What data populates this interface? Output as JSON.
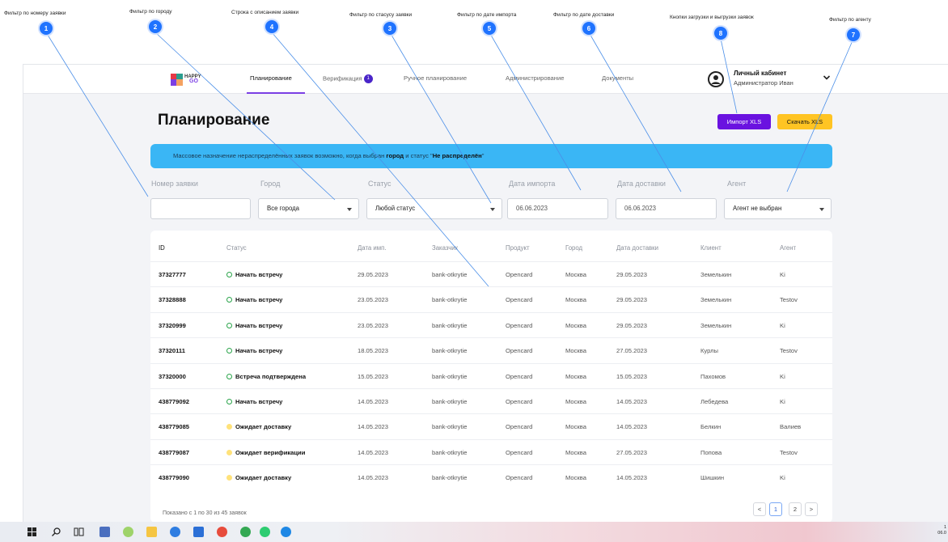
{
  "annotations": [
    {
      "num": "1",
      "label": "Фильтр по номеру заявки"
    },
    {
      "num": "2",
      "label": "Фильтр по городу"
    },
    {
      "num": "4",
      "label": "Строка с описанием заявки"
    },
    {
      "num": "3",
      "label": "Фильтр по стасусу заявки"
    },
    {
      "num": "5",
      "label": "Фильтр по дате импорта"
    },
    {
      "num": "6",
      "label": "Фильтр по дате доставки"
    },
    {
      "num": "8",
      "label": "Кнопки загрузки и выгрузки заявок"
    },
    {
      "num": "7",
      "label": "Фильтр по агенту"
    }
  ],
  "header": {
    "logo": {
      "top": "HAPPY",
      "bottom": "GO"
    },
    "nav": [
      {
        "label": "Планирование",
        "active": true
      },
      {
        "label": "Верификация",
        "badge": "1"
      },
      {
        "label": "Ручное планирование"
      },
      {
        "label": "Администрирование"
      },
      {
        "label": "Документы"
      }
    ],
    "user": {
      "name": "Личный кабинет",
      "role": "Администратор Иван"
    }
  },
  "page": {
    "title": "Планирование",
    "import_label": "Импорт XLS",
    "export_label": "Скачать XLS"
  },
  "banner": {
    "text_1": "Массовое назначение нераспределённых заявок возможно, когда выбран ",
    "bold_1": "город",
    "text_2": " и статус \"",
    "bold_2": "Не распределён",
    "text_3": "\""
  },
  "filters": {
    "number": {
      "label": "Номер заявки",
      "value": ""
    },
    "city": {
      "label": "Город",
      "value": "Все города"
    },
    "status": {
      "label": "Статус",
      "value": "Любой статус"
    },
    "import_date": {
      "label": "Дата импорта",
      "value": "06.06.2023"
    },
    "delivery_date": {
      "label": "Дата доставки",
      "value": "06.06.2023"
    },
    "agent": {
      "label": "Агент",
      "value": "Агент не выбран"
    }
  },
  "table": {
    "columns": [
      "ID",
      "Статус",
      "Дата имп.",
      "Заказчик",
      "Продукт",
      "Город",
      "Дата доставки",
      "Клиент",
      "Агент"
    ],
    "rows": [
      {
        "id": "37327777",
        "status": "Начать встречу",
        "status_color": "green",
        "import": "29.05.2023",
        "customer": "bank-otkrytie",
        "product": "Opencard",
        "city": "Москва",
        "delivery": "29.05.2023",
        "client": "Земелькин",
        "agent": "Ki"
      },
      {
        "id": "37328888",
        "status": "Начать встречу",
        "status_color": "green",
        "import": "23.05.2023",
        "customer": "bank-otkrytie",
        "product": "Opencard",
        "city": "Москва",
        "delivery": "29.05.2023",
        "client": "Земелькин",
        "agent": "Testov"
      },
      {
        "id": "37320999",
        "status": "Начать встречу",
        "status_color": "green",
        "import": "23.05.2023",
        "customer": "bank-otkrytie",
        "product": "Opencard",
        "city": "Москва",
        "delivery": "29.05.2023",
        "client": "Земелькин",
        "agent": "Ki"
      },
      {
        "id": "37320111",
        "status": "Начать встречу",
        "status_color": "green",
        "import": "18.05.2023",
        "customer": "bank-otkrytie",
        "product": "Opencard",
        "city": "Москва",
        "delivery": "27.05.2023",
        "client": "Курлы",
        "agent": "Testov"
      },
      {
        "id": "37320000",
        "status": "Встреча подтверждена",
        "status_color": "green",
        "import": "15.05.2023",
        "customer": "bank-otkrytie",
        "product": "Opencard",
        "city": "Москва",
        "delivery": "15.05.2023",
        "client": "Пахомов",
        "agent": "Ki"
      },
      {
        "id": "438779092",
        "status": "Начать встречу",
        "status_color": "green",
        "import": "14.05.2023",
        "customer": "bank-otkrytie",
        "product": "Opencard",
        "city": "Москва",
        "delivery": "14.05.2023",
        "client": "Лебедева",
        "agent": "Ki"
      },
      {
        "id": "438779085",
        "status": "Ожидает доставку",
        "status_color": "yellow",
        "import": "14.05.2023",
        "customer": "bank-otkrytie",
        "product": "Opencard",
        "city": "Москва",
        "delivery": "14.05.2023",
        "client": "Белкин",
        "agent": "Валиев"
      },
      {
        "id": "438779087",
        "status": "Ожидает верификации",
        "status_color": "yellow",
        "import": "14.05.2023",
        "customer": "bank-otkrytie",
        "product": "Opencard",
        "city": "Москва",
        "delivery": "27.05.2023",
        "client": "Попова",
        "agent": "Testov"
      },
      {
        "id": "438779090",
        "status": "Ожидает доставку",
        "status_color": "yellow",
        "import": "14.05.2023",
        "customer": "bank-otkrytie",
        "product": "Opencard",
        "city": "Москва",
        "delivery": "14.05.2023",
        "client": "Шишкин",
        "agent": "Ki"
      }
    ]
  },
  "pagination": {
    "summary": "Показано с 1 по 30 из 45 заявок",
    "prev": "<",
    "pages": [
      "1",
      "2"
    ],
    "next": ">"
  },
  "taskbar": {
    "time": "1",
    "date": "06.0"
  },
  "colors": {
    "accent": "#7b3fe4",
    "import_button": "#6a12e0",
    "export_button": "#ffc423",
    "banner": "#3ab6f5",
    "badge": "#1f73ff"
  }
}
